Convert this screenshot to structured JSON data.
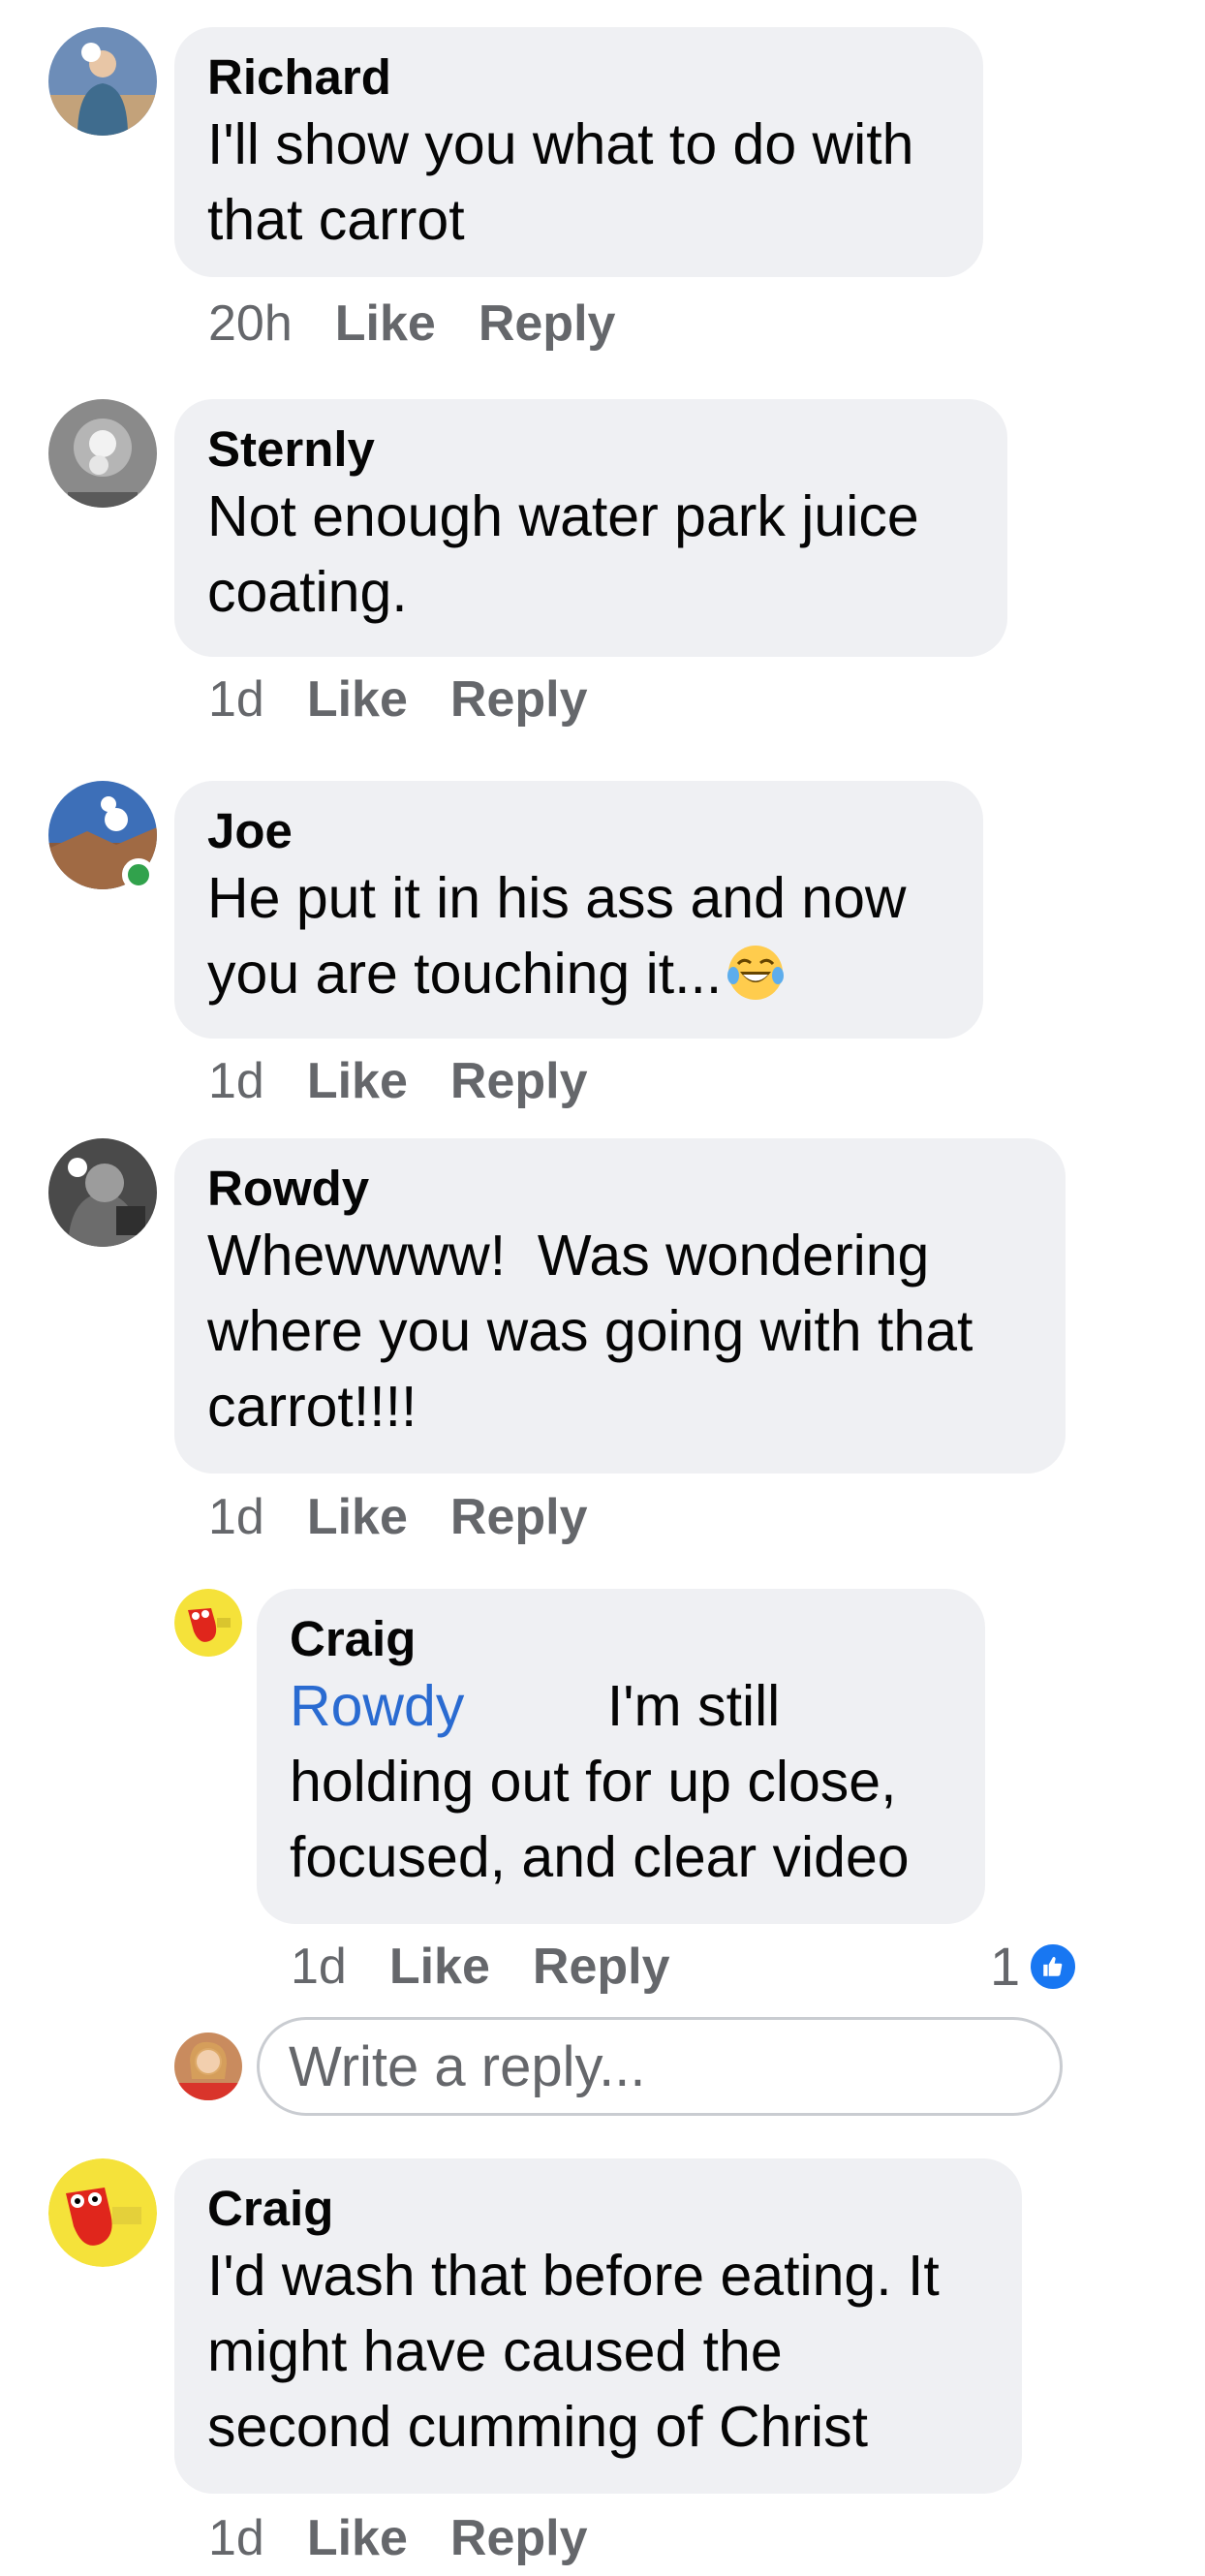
{
  "actions": {
    "like": "Like",
    "reply": "Reply"
  },
  "comments": [
    {
      "author": "Richard",
      "text": "I'll show you what to do with\nthat carrot",
      "time": "20h"
    },
    {
      "author": "Sternly",
      "text": "Not enough water park juice\ncoating.",
      "time": "1d"
    },
    {
      "author": "Joe",
      "text": "He put it in his ass and now\nyou are touching it...",
      "emoji": "face-with-tears-of-joy",
      "time": "1d"
    },
    {
      "author": "Rowdy",
      "text": "Whewwww!  Was wondering\nwhere you was going with that\ncarrot!!!!",
      "time": "1d"
    },
    {
      "author": "Craig",
      "mention": "Rowdy",
      "text_after_mention": "         I'm still",
      "text": "holding out for up close,\nfocused, and clear video",
      "time": "1d",
      "reaction_count": "1",
      "reaction_type": "like"
    },
    {
      "author": "Craig",
      "text": "I'd wash that before eating. It\nmight have caused the\nsecond cumming of Christ",
      "time": "1d"
    }
  ],
  "reply_box": {
    "placeholder": "Write a reply..."
  },
  "colors": {
    "bubble": "#eff0f3",
    "meta_text": "#65676b",
    "mention": "#2a6bd1",
    "like_blue": "#1877f2",
    "online_green": "#31a24c"
  }
}
